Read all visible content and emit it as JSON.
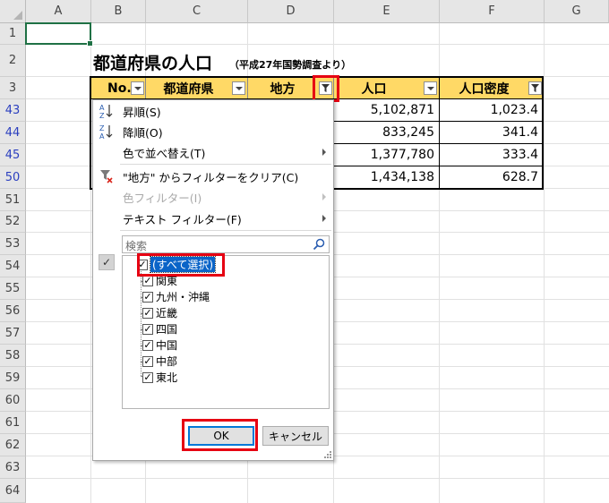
{
  "columns": [
    "A",
    "B",
    "C",
    "D",
    "E",
    "F",
    "G"
  ],
  "rows": [
    "1",
    "2",
    "3",
    "43",
    "44",
    "45",
    "50",
    "51",
    "52",
    "53",
    "54",
    "55",
    "56",
    "57",
    "58",
    "59",
    "60",
    "61",
    "62",
    "63",
    "64"
  ],
  "sheet": {
    "title": "都道府県の人口",
    "subtitle": "（平成27年国勢調査より）",
    "headers": [
      "No.",
      "都道府県",
      "地方",
      "人口",
      "人口密度"
    ],
    "population": [
      "5,102,871",
      "833,245",
      "1,377,780",
      "1,434,138"
    ],
    "density": [
      "1,023.4",
      "341.4",
      "333.4",
      "628.7"
    ]
  },
  "filter_menu": {
    "sort_asc": "昇順(S)",
    "sort_desc": "降順(O)",
    "sort_color": "色で並べ替え(T)",
    "clear_filter": "\"地方\" からフィルターをクリア(C)",
    "color_filter": "色フィルター(I)",
    "text_filter": "テキスト フィルター(F)",
    "search_placeholder": "検索",
    "items": {
      "select_all": "(すべて選択)",
      "list": [
        "関東",
        "九州・沖縄",
        "近畿",
        "四国",
        "中国",
        "中部",
        "東北"
      ]
    },
    "ok": "OK",
    "cancel": "キャンセル"
  },
  "colors": {
    "header_fill": "#ffd966",
    "highlight": "#e60012",
    "selection": "#1f7145",
    "filtered_row_number": "#2b3fbf"
  },
  "icons": {
    "sort_asc": "sort-az-icon",
    "sort_desc": "sort-za-icon",
    "clear_filter": "clear-filter-icon",
    "search": "magnifier-icon",
    "checked": "checkmark-icon"
  }
}
